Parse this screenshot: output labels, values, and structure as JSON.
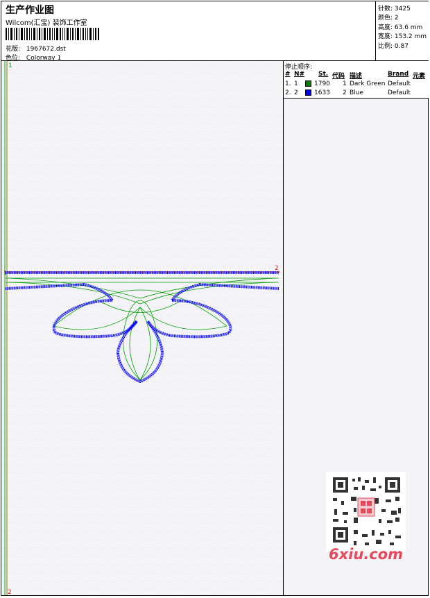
{
  "header": {
    "title": "生产作业图",
    "studio": "Wilcom(汇宝) 装饰工作室",
    "design_label": "花版:",
    "design_value": "1967672.dst",
    "colorway_label": "色位:",
    "colorway_value": "Colorway 1"
  },
  "stats": {
    "stitches": "针数: 3425",
    "colors": "颜色: 2",
    "height": "高度: 63.6 mm",
    "width": "宽度: 153.2 mm",
    "scale": "比例: 0.87"
  },
  "stop_sequence": {
    "title": "停止顺序:",
    "headers": [
      "#",
      "N#",
      "St.",
      "代码",
      "描述",
      "Brand",
      "元素"
    ],
    "rows": [
      {
        "idx": "1.",
        "n": "1",
        "st": "1790",
        "code": "1",
        "desc": "Dark Green",
        "brand": "Default",
        "color": "#008000"
      },
      {
        "idx": "2.",
        "n": "2",
        "st": "1633",
        "code": "2",
        "desc": "Blue",
        "brand": "Default",
        "color": "#0000ff"
      }
    ]
  },
  "canvas": {
    "top_marker": "1",
    "bottom_marker": "2",
    "start_marker": "1",
    "end_marker": "2"
  },
  "watermark": {
    "text": "6xiu.com"
  }
}
